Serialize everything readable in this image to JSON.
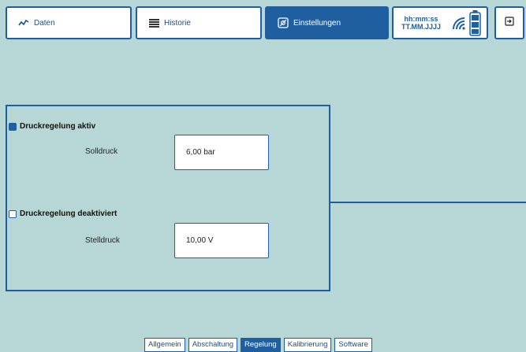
{
  "tabs": [
    {
      "label": "Daten",
      "icon": "trend-line-icon"
    },
    {
      "label": "Historie",
      "icon": "list-icon"
    },
    {
      "label": "Einstellungen",
      "icon": "settings-icon",
      "active": true
    }
  ],
  "status": {
    "time": "hh:mm:ss",
    "date": "TT.MM.JJJJ",
    "wifi_icon": "wifi-icon",
    "battery_icon": "battery-icon"
  },
  "logout_icon": "logout-icon",
  "regulation": {
    "active_option": {
      "label": "Druckregelung aktiv",
      "checked": true,
      "field_label": "Solldruck",
      "field_value": "6,00 bar"
    },
    "inactive_option": {
      "label": "Druckregelung deaktiviert",
      "checked": false,
      "field_label": "Stelldruck",
      "field_value": "10,00 V"
    }
  },
  "subtabs": [
    {
      "label": "Allgemein"
    },
    {
      "label": "Abschaltung"
    },
    {
      "label": "Regelung",
      "active": true
    },
    {
      "label": "Kalibrierung"
    },
    {
      "label": "Software"
    }
  ],
  "colors": {
    "accent": "#1f5fa0",
    "background": "#b7d6d6"
  }
}
